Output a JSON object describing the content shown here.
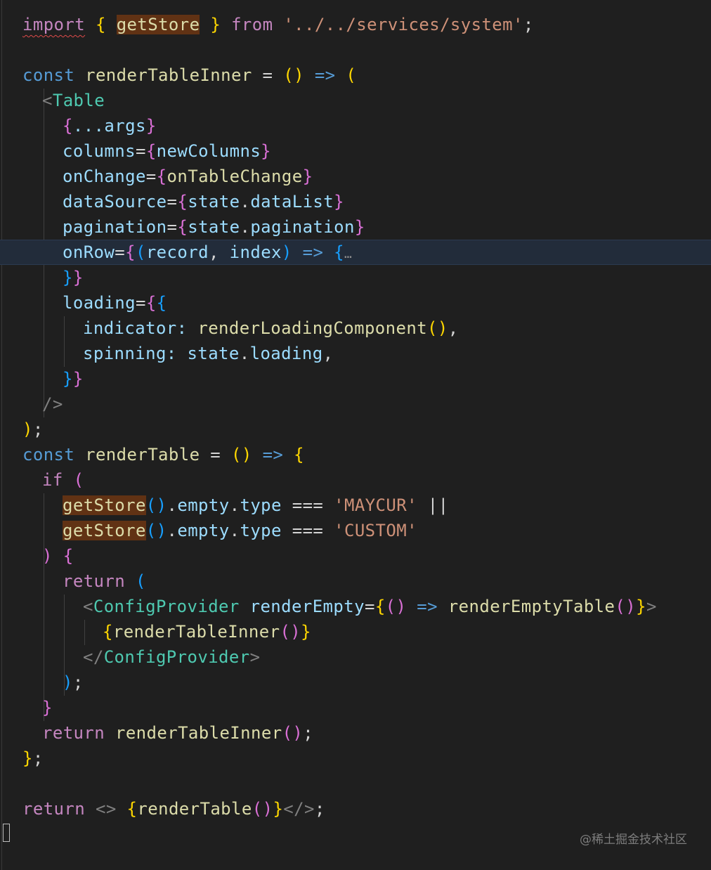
{
  "editor": {
    "watermark": "@稀土掘金技术社区",
    "lines": [
      {
        "id": "l01",
        "tokens": [
          {
            "t": "import",
            "c": "ctl squiggle"
          },
          {
            "t": " ",
            "c": "pun"
          },
          {
            "t": "{",
            "c": "br1"
          },
          {
            "t": " ",
            "c": "pun"
          },
          {
            "t": "getStore",
            "c": "fn hl"
          },
          {
            "t": " ",
            "c": "pun"
          },
          {
            "t": "}",
            "c": "br1"
          },
          {
            "t": " ",
            "c": "pun"
          },
          {
            "t": "from",
            "c": "ctl"
          },
          {
            "t": " ",
            "c": "pun"
          },
          {
            "t": "'../../services/system'",
            "c": "str"
          },
          {
            "t": ";",
            "c": "pun"
          }
        ]
      },
      {
        "id": "l03",
        "tokens": [
          {
            "t": "const",
            "c": "kw"
          },
          {
            "t": " ",
            "c": "pun"
          },
          {
            "t": "renderTableInner",
            "c": "fn"
          },
          {
            "t": " = ",
            "c": "pun"
          },
          {
            "t": "()",
            "c": "br1"
          },
          {
            "t": " ",
            "c": "pun"
          },
          {
            "t": "=>",
            "c": "kw"
          },
          {
            "t": " ",
            "c": "pun"
          },
          {
            "t": "(",
            "c": "br1"
          }
        ]
      },
      {
        "id": "l04",
        "tokens": [
          {
            "t": "<",
            "c": "ang"
          },
          {
            "t": "Table",
            "c": "tag"
          }
        ]
      },
      {
        "id": "l05",
        "tokens": [
          {
            "t": "{",
            "c": "br2"
          },
          {
            "t": "...args",
            "c": "var"
          },
          {
            "t": "}",
            "c": "br2"
          }
        ]
      },
      {
        "id": "l06",
        "tokens": [
          {
            "t": "columns",
            "c": "var"
          },
          {
            "t": "=",
            "c": "pun"
          },
          {
            "t": "{",
            "c": "br2"
          },
          {
            "t": "newColumns",
            "c": "var"
          },
          {
            "t": "}",
            "c": "br2"
          }
        ]
      },
      {
        "id": "l07",
        "tokens": [
          {
            "t": "onChange",
            "c": "var"
          },
          {
            "t": "=",
            "c": "pun"
          },
          {
            "t": "{",
            "c": "br2"
          },
          {
            "t": "onTableChange",
            "c": "fn"
          },
          {
            "t": "}",
            "c": "br2"
          }
        ]
      },
      {
        "id": "l08",
        "tokens": [
          {
            "t": "dataSource",
            "c": "var"
          },
          {
            "t": "=",
            "c": "pun"
          },
          {
            "t": "{",
            "c": "br2"
          },
          {
            "t": "state",
            "c": "var"
          },
          {
            "t": ".",
            "c": "pun"
          },
          {
            "t": "dataList",
            "c": "var"
          },
          {
            "t": "}",
            "c": "br2"
          }
        ]
      },
      {
        "id": "l09",
        "tokens": [
          {
            "t": "pagination",
            "c": "var"
          },
          {
            "t": "=",
            "c": "pun"
          },
          {
            "t": "{",
            "c": "br2"
          },
          {
            "t": "state",
            "c": "var"
          },
          {
            "t": ".",
            "c": "pun"
          },
          {
            "t": "pagination",
            "c": "var"
          },
          {
            "t": "}",
            "c": "br2"
          }
        ]
      },
      {
        "id": "l10",
        "tokens": [
          {
            "t": "onRow",
            "c": "var"
          },
          {
            "t": "=",
            "c": "pun"
          },
          {
            "t": "{",
            "c": "br2"
          },
          {
            "t": "(",
            "c": "br3"
          },
          {
            "t": "record",
            "c": "var"
          },
          {
            "t": ", ",
            "c": "pun"
          },
          {
            "t": "index",
            "c": "var"
          },
          {
            "t": ")",
            "c": "br3"
          },
          {
            "t": " ",
            "c": "pun"
          },
          {
            "t": "=>",
            "c": "kw"
          },
          {
            "t": " ",
            "c": "pun"
          },
          {
            "t": "{",
            "c": "br3"
          },
          {
            "t": "…",
            "c": "fold"
          }
        ]
      },
      {
        "id": "l11",
        "tokens": [
          {
            "t": "}",
            "c": "br3"
          },
          {
            "t": "}",
            "c": "br2"
          }
        ]
      },
      {
        "id": "l12",
        "tokens": [
          {
            "t": "loading",
            "c": "var"
          },
          {
            "t": "=",
            "c": "pun"
          },
          {
            "t": "{",
            "c": "br2"
          },
          {
            "t": "{",
            "c": "br3"
          }
        ]
      },
      {
        "id": "l13",
        "tokens": [
          {
            "t": "indicator",
            "c": "var"
          },
          {
            "t": ": ",
            "c": "var"
          },
          {
            "t": "renderLoadingComponent",
            "c": "fn"
          },
          {
            "t": "()",
            "c": "br1"
          },
          {
            "t": ",",
            "c": "pun"
          }
        ]
      },
      {
        "id": "l14",
        "tokens": [
          {
            "t": "spinning",
            "c": "var"
          },
          {
            "t": ": ",
            "c": "var"
          },
          {
            "t": "state",
            "c": "var"
          },
          {
            "t": ".",
            "c": "pun"
          },
          {
            "t": "loading",
            "c": "var"
          },
          {
            "t": ",",
            "c": "pun"
          }
        ]
      },
      {
        "id": "l15",
        "tokens": [
          {
            "t": "}",
            "c": "br3"
          },
          {
            "t": "}",
            "c": "br2"
          }
        ]
      },
      {
        "id": "l16",
        "tokens": [
          {
            "t": "/>",
            "c": "ang"
          }
        ]
      },
      {
        "id": "l17",
        "tokens": [
          {
            "t": ")",
            "c": "br1"
          },
          {
            "t": ";",
            "c": "pun"
          }
        ]
      },
      {
        "id": "l18",
        "tokens": [
          {
            "t": "const",
            "c": "kw"
          },
          {
            "t": " ",
            "c": "pun"
          },
          {
            "t": "renderTable",
            "c": "fn"
          },
          {
            "t": " = ",
            "c": "pun"
          },
          {
            "t": "()",
            "c": "br1"
          },
          {
            "t": " ",
            "c": "pun"
          },
          {
            "t": "=>",
            "c": "kw"
          },
          {
            "t": " ",
            "c": "pun"
          },
          {
            "t": "{",
            "c": "br1"
          }
        ]
      },
      {
        "id": "l19",
        "tokens": [
          {
            "t": "if",
            "c": "ctl"
          },
          {
            "t": " ",
            "c": "pun"
          },
          {
            "t": "(",
            "c": "br2"
          }
        ]
      },
      {
        "id": "l20",
        "tokens": [
          {
            "t": "getStore",
            "c": "fn hl"
          },
          {
            "t": "()",
            "c": "br3"
          },
          {
            "t": ".",
            "c": "pun"
          },
          {
            "t": "empty",
            "c": "var"
          },
          {
            "t": ".",
            "c": "pun"
          },
          {
            "t": "type",
            "c": "var"
          },
          {
            "t": " === ",
            "c": "pun"
          },
          {
            "t": "'MAYCUR'",
            "c": "str"
          },
          {
            "t": " ||",
            "c": "pun"
          }
        ]
      },
      {
        "id": "l21",
        "tokens": [
          {
            "t": "getStore",
            "c": "fn hl"
          },
          {
            "t": "()",
            "c": "br3"
          },
          {
            "t": ".",
            "c": "pun"
          },
          {
            "t": "empty",
            "c": "var"
          },
          {
            "t": ".",
            "c": "pun"
          },
          {
            "t": "type",
            "c": "var"
          },
          {
            "t": " === ",
            "c": "pun"
          },
          {
            "t": "'CUSTOM'",
            "c": "str"
          }
        ]
      },
      {
        "id": "l22",
        "tokens": [
          {
            "t": ")",
            "c": "br2"
          },
          {
            "t": " ",
            "c": "pun"
          },
          {
            "t": "{",
            "c": "br2"
          }
        ]
      },
      {
        "id": "l23",
        "tokens": [
          {
            "t": "return",
            "c": "ctl"
          },
          {
            "t": " ",
            "c": "pun"
          },
          {
            "t": "(",
            "c": "br3"
          }
        ]
      },
      {
        "id": "l24",
        "tokens": [
          {
            "t": "<",
            "c": "ang"
          },
          {
            "t": "ConfigProvider",
            "c": "tag"
          },
          {
            "t": " ",
            "c": "pun"
          },
          {
            "t": "renderEmpty",
            "c": "var"
          },
          {
            "t": "=",
            "c": "pun"
          },
          {
            "t": "{",
            "c": "br1"
          },
          {
            "t": "()",
            "c": "br2"
          },
          {
            "t": " ",
            "c": "pun"
          },
          {
            "t": "=>",
            "c": "kw"
          },
          {
            "t": " ",
            "c": "pun"
          },
          {
            "t": "renderEmptyTable",
            "c": "fn"
          },
          {
            "t": "()",
            "c": "br2"
          },
          {
            "t": "}",
            "c": "br1"
          },
          {
            "t": ">",
            "c": "ang"
          }
        ]
      },
      {
        "id": "l25",
        "tokens": [
          {
            "t": "{",
            "c": "br1"
          },
          {
            "t": "renderTableInner",
            "c": "fn"
          },
          {
            "t": "()",
            "c": "br2"
          },
          {
            "t": "}",
            "c": "br1"
          }
        ]
      },
      {
        "id": "l26",
        "tokens": [
          {
            "t": "</",
            "c": "ang"
          },
          {
            "t": "ConfigProvider",
            "c": "tag"
          },
          {
            "t": ">",
            "c": "ang"
          }
        ]
      },
      {
        "id": "l27",
        "tokens": [
          {
            "t": ")",
            "c": "br3"
          },
          {
            "t": ";",
            "c": "pun"
          }
        ]
      },
      {
        "id": "l28",
        "tokens": [
          {
            "t": "}",
            "c": "br2"
          }
        ]
      },
      {
        "id": "l29",
        "tokens": [
          {
            "t": "return",
            "c": "ctl"
          },
          {
            "t": " ",
            "c": "pun"
          },
          {
            "t": "renderTableInner",
            "c": "fn"
          },
          {
            "t": "()",
            "c": "br2"
          },
          {
            "t": ";",
            "c": "pun"
          }
        ]
      },
      {
        "id": "l30",
        "tokens": [
          {
            "t": "}",
            "c": "br1"
          },
          {
            "t": ";",
            "c": "pun"
          }
        ]
      },
      {
        "id": "l32",
        "tokens": [
          {
            "t": "return",
            "c": "ctl"
          },
          {
            "t": " ",
            "c": "pun"
          },
          {
            "t": "<>",
            "c": "ang"
          },
          {
            "t": " ",
            "c": "pun"
          },
          {
            "t": "{",
            "c": "br1"
          },
          {
            "t": "renderTable",
            "c": "fn"
          },
          {
            "t": "()",
            "c": "br2"
          },
          {
            "t": "}",
            "c": "br1"
          },
          {
            "t": "</>",
            "c": "ang"
          },
          {
            "t": ";",
            "c": "pun"
          }
        ]
      }
    ]
  }
}
